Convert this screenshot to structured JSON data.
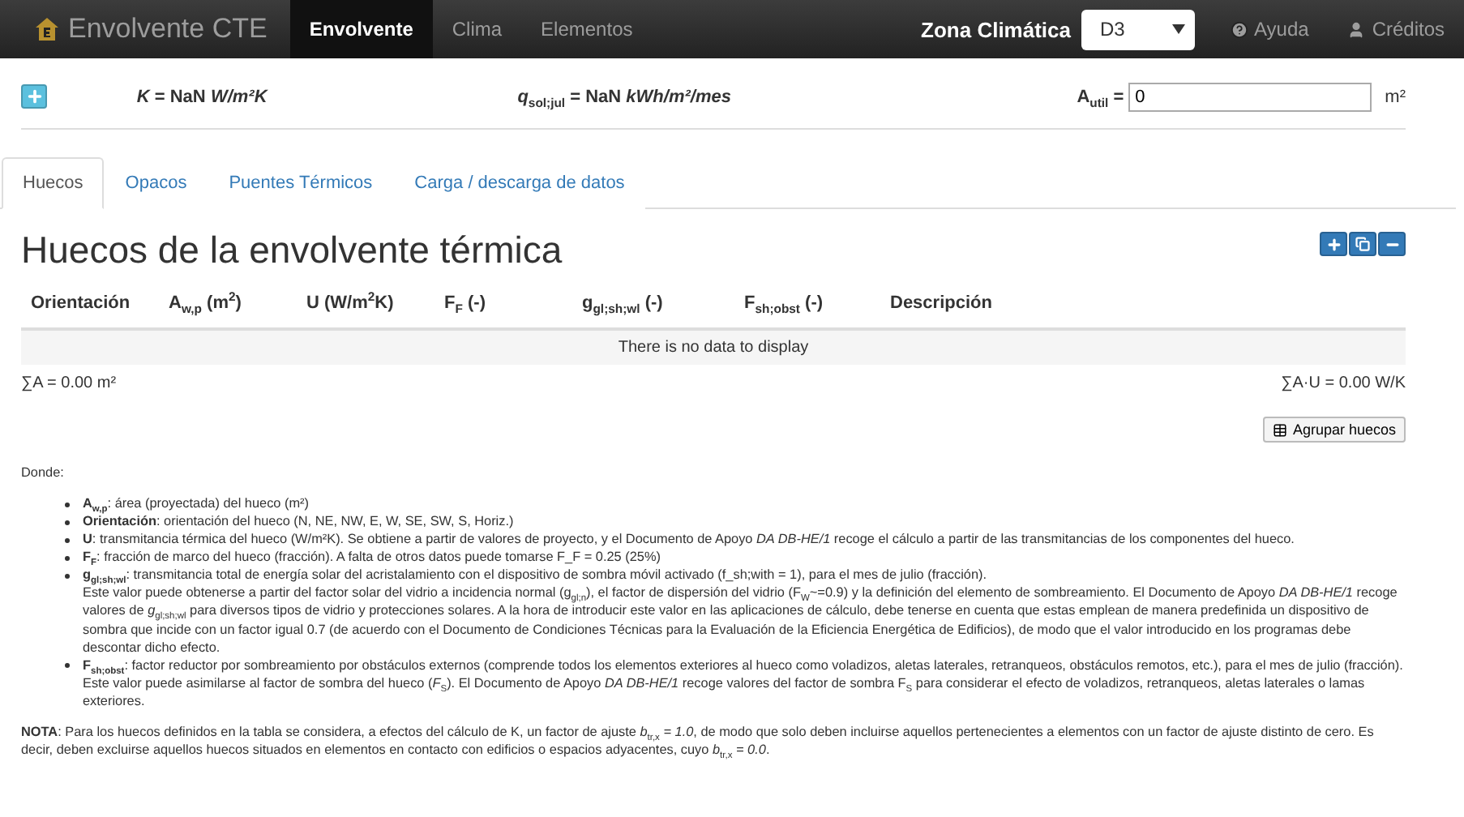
{
  "navbar": {
    "brand": "Envolvente CTE",
    "items": [
      {
        "label": "Envolvente",
        "selected": true
      },
      {
        "label": "Clima",
        "selected": false
      },
      {
        "label": "Elementos",
        "selected": false
      }
    ],
    "zone_label": "Zona Climática",
    "zone_value": "D3",
    "links": [
      {
        "kind": "help",
        "label": "Ayuda"
      },
      {
        "kind": "user",
        "label": "Créditos"
      }
    ]
  },
  "summary": {
    "k": "*K* = NaN *W/m²K*",
    "q": "*q*$_{sol;jul}$ = NaN *kWh/m²/mes*",
    "area_label": "A$_{util}$ =",
    "area_value": "0",
    "area_unit": "m²"
  },
  "tabs": [
    {
      "label": "Huecos",
      "selected": true
    },
    {
      "label": "Opacos",
      "selected": false
    },
    {
      "label": "Puentes Térmicos",
      "selected": false
    },
    {
      "label": "Carga / descarga de datos",
      "selected": false
    }
  ],
  "section": {
    "title": "Huecos de la envolvente térmica",
    "columns": [
      "Orientación",
      "A$_{w,p}$ (m$^{2}$)",
      "U (W/m$^{2}$K)",
      "F$_{F}$ (-)",
      "g$_{gl;sh;wl}$ (-)",
      "F$_{sh;obst}$ (-)",
      "Descripción"
    ],
    "empty_message": "There is no data to display",
    "sum_area": "∑A = 0.00 m²",
    "sum_au": "∑A·U = 0.00 W/K",
    "group_button": "Agrupar huecos"
  },
  "legend": {
    "intro": "Donde:",
    "items": [
      {
        "paragraphs": [
          "**A$_{w,p}$**: área (proyectada) del hueco (m²)"
        ]
      },
      {
        "paragraphs": [
          "**Orientación**: orientación del hueco (N, NE, NW, E, W, SE, SW, S, Horiz.)"
        ]
      },
      {
        "paragraphs": [
          "**U**: transmitancia térmica del hueco (W/m²K). Se obtiene a partir de valores de proyecto, y el Documento de Apoyo *DA DB-HE/1* recoge el cálculo a partir de las transmitancias de los componentes del hueco."
        ]
      },
      {
        "paragraphs": [
          "**F$_{F}$**: fracción de marco del hueco (fracción). A falta de otros datos puede tomarse F_F = 0.25 (25%)"
        ]
      },
      {
        "paragraphs": [
          "**g$_{gl;sh;wl}$**: transmitancia total de energía solar del acristalamiento con el dispositivo de sombra móvil activado (f_sh;with = 1), para el mes de julio (fracción).",
          "Este valor puede obtenerse a partir del factor solar del vidrio a incidencia normal (g$_{gl;n}$), el factor de dispersión del vidrio (F$_{W}$~=0.9) y la definición del elemento de sombreamiento. El Documento de Apoyo *DA DB-HE/1* recoge valores de *g*$_{gl;sh;wl}$ para diversos tipos de vidrio y protecciones solares. A la hora de introducir este valor en las aplicaciones de cálculo, debe tenerse en cuenta que estas emplean de manera predefinida un dispositivo de sombra que incide con un factor igual 0.7 (de acuerdo con el Documento de Condiciones Técnicas para la Evaluación de la Eficiencia Energética de Edificios), de modo que el valor introducido en los programas debe descontar dicho efecto."
        ]
      },
      {
        "paragraphs": [
          "**F$_{sh;obst}$**: factor reductor por sombreamiento por obstáculos externos (comprende todos los elementos exteriores al hueco como voladizos, aletas laterales, retranqueos, obstáculos remotos, etc.), para el mes de julio (fracción).",
          "Este valor puede asimilarse al factor de sombra del hueco (*F*$_{S}$). El Documento de Apoyo *DA DB-HE/1* recoge valores del factor de sombra F$_{S}$ para considerar el efecto de voladizos, retranqueos, aletas laterales o lamas exteriores."
        ]
      }
    ],
    "note": "**NOTA**: Para los huecos definidos en la tabla se considera, a efectos del cálculo de K, un factor de ajuste *b*$_{tr,x}$ *= 1.0*, de modo que solo deben incluirse aquellos pertenecientes a elementos con un factor de ajuste distinto de cero. Es decir, deben excluirse aquellos huecos situados en elementos en contacto con edificios o espacios adyacentes, cuyo *b*$_{tr,x}$ *= 0.0*."
  }
}
